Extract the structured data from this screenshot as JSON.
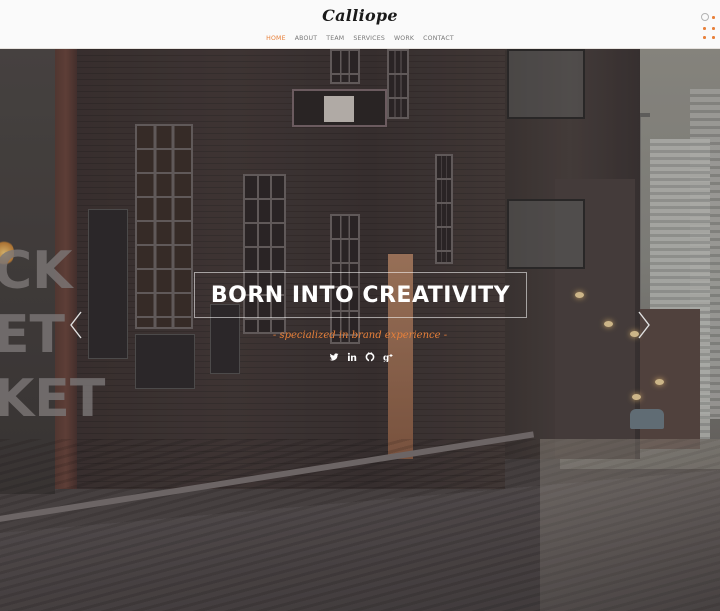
{
  "header": {
    "logo": "Calliope",
    "nav": [
      {
        "label": "HOME",
        "active": true
      },
      {
        "label": "ABOUT",
        "active": false
      },
      {
        "label": "TEAM",
        "active": false
      },
      {
        "label": "SERVICES",
        "active": false
      },
      {
        "label": "WORK",
        "active": false
      },
      {
        "label": "CONTACT",
        "active": false
      }
    ],
    "menu_icon": "menu-dots-icon"
  },
  "hero": {
    "title": "BORN INTO CREATIVITY",
    "tagline": "- specialized in brand experience -",
    "social": [
      {
        "name": "twitter",
        "glyph": "t"
      },
      {
        "name": "linkedin",
        "glyph": "in"
      },
      {
        "name": "github",
        "glyph": "◯"
      },
      {
        "name": "google-plus",
        "glyph": "g+"
      }
    ],
    "prev_icon": "chevron-left-icon",
    "next_icon": "chevron-right-icon",
    "background_scene": "cobblestone street with brick buildings",
    "shop_sign_letters": "CK\nET\nKET"
  },
  "colors": {
    "accent": "#e8803a",
    "header_bg": "#fafafa",
    "nav_text": "#777777",
    "title_text": "#ffffff"
  }
}
